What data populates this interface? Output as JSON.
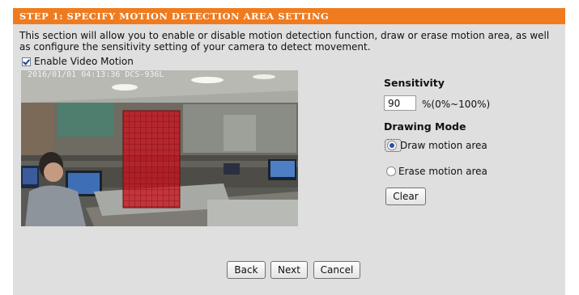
{
  "header": {
    "title": "STEP 1: SPECIFY MOTION DETECTION AREA SETTING"
  },
  "description": "This section will allow you to enable or disable motion detection function, draw or erase motion area, as well as configure the sensitivity setting of your camera to detect movement.",
  "enable_video_motion": {
    "label": "Enable Video Motion",
    "checked": true
  },
  "camera": {
    "timestamp": "2016/01/01 04:13:36 DCS-936L"
  },
  "sensitivity": {
    "label": "Sensitivity",
    "value": "90",
    "range_text": "%(0%~100%)"
  },
  "drawing_mode": {
    "label": "Drawing Mode",
    "options": [
      {
        "label": "Draw motion area",
        "selected": true
      },
      {
        "label": "Erase motion area",
        "selected": false
      }
    ]
  },
  "buttons": {
    "clear": "Clear",
    "back": "Back",
    "next": "Next",
    "cancel": "Cancel"
  },
  "colors": {
    "header": "#f07a1e",
    "panel": "#dfdfdf",
    "motion_area": "#c8141e"
  }
}
